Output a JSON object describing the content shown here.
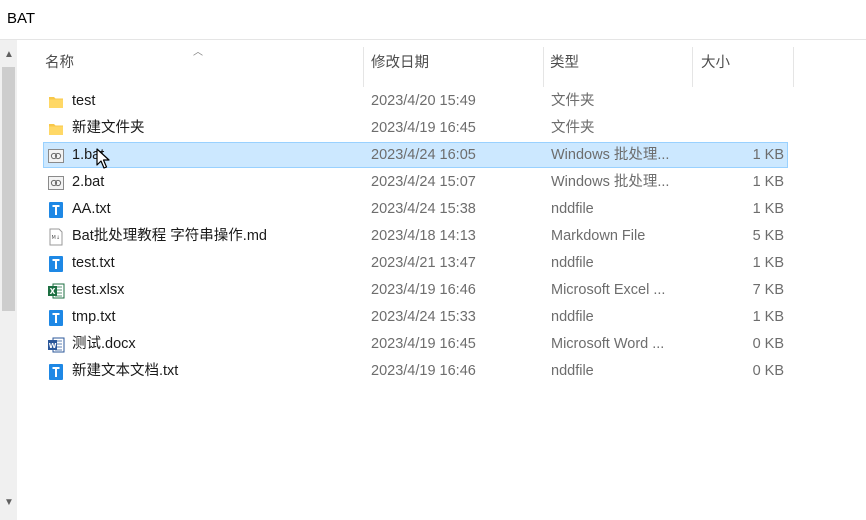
{
  "address": {
    "path": "BAT"
  },
  "columns": {
    "name": "名称",
    "date": "修改日期",
    "type": "类型",
    "size": "大小"
  },
  "colors": {
    "selected_bg": "#cce8ff",
    "selected_border": "#99d1ff",
    "folder": "#f8c84a",
    "txt_icon": "#1e88e5",
    "excel": "#1d6f42",
    "word": "#2b579a"
  },
  "files": [
    {
      "name": "test",
      "date": "2023/4/20 15:49",
      "type": "文件夹",
      "size": "",
      "icon": "folder-icon"
    },
    {
      "name": "新建文件夹",
      "date": "2023/4/19 16:45",
      "type": "文件夹",
      "size": "",
      "icon": "folder-icon"
    },
    {
      "name": "1.bat",
      "date": "2023/4/24 16:05",
      "type": "Windows 批处理...",
      "size": "1 KB",
      "icon": "batch-file-icon",
      "selected": true
    },
    {
      "name": "2.bat",
      "date": "2023/4/24 15:07",
      "type": "Windows 批处理...",
      "size": "1 KB",
      "icon": "batch-file-icon"
    },
    {
      "name": "AA.txt",
      "date": "2023/4/24 15:38",
      "type": "nddfile",
      "size": "1 KB",
      "icon": "text-file-icon"
    },
    {
      "name": "Bat批处理教程 字符串操作.md",
      "date": "2023/4/18 14:13",
      "type": "Markdown File",
      "size": "5 KB",
      "icon": "markdown-file-icon"
    },
    {
      "name": "test.txt",
      "date": "2023/4/21 13:47",
      "type": "nddfile",
      "size": "1 KB",
      "icon": "text-file-icon"
    },
    {
      "name": "test.xlsx",
      "date": "2023/4/19 16:46",
      "type": "Microsoft Excel ...",
      "size": "7 KB",
      "icon": "excel-file-icon"
    },
    {
      "name": "tmp.txt",
      "date": "2023/4/24 15:33",
      "type": "nddfile",
      "size": "1 KB",
      "icon": "text-file-icon"
    },
    {
      "name": "测试.docx",
      "date": "2023/4/19 16:45",
      "type": "Microsoft Word ...",
      "size": "0 KB",
      "icon": "word-file-icon"
    },
    {
      "name": "新建文本文档.txt",
      "date": "2023/4/19 16:46",
      "type": "nddfile",
      "size": "0 KB",
      "icon": "text-file-icon"
    }
  ]
}
